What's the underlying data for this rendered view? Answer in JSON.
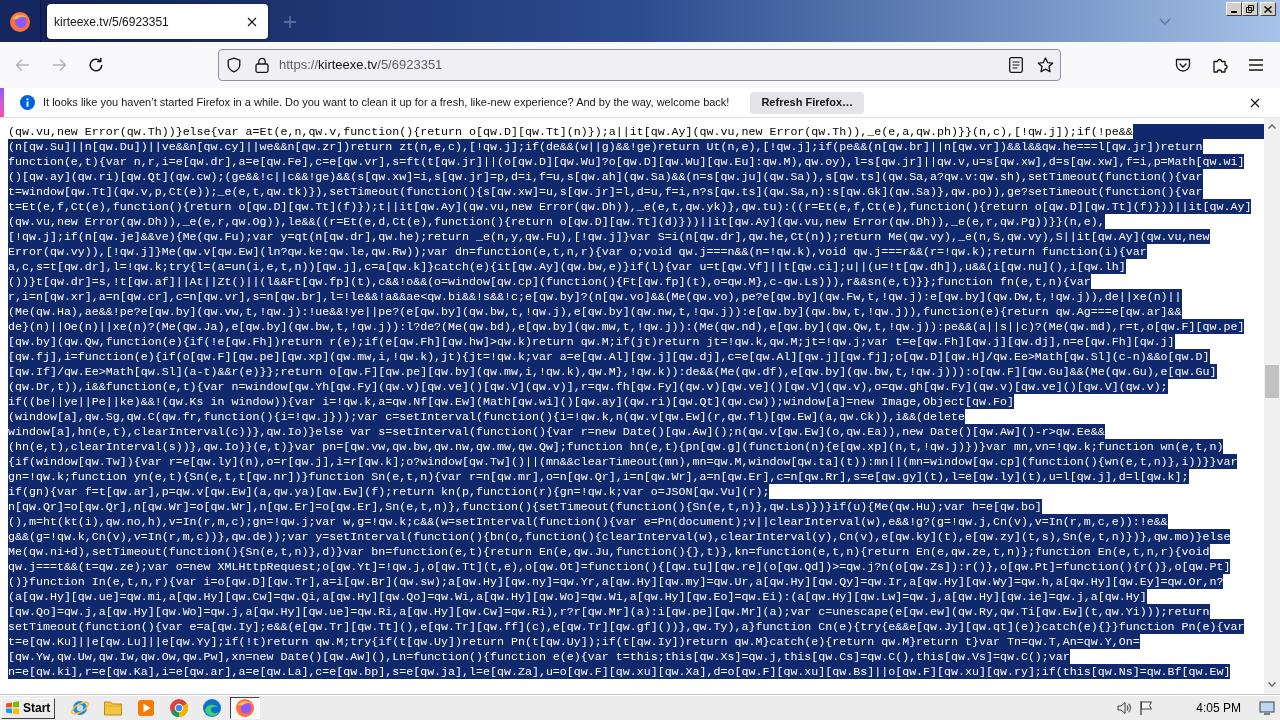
{
  "browser": {
    "tabs": [
      {
        "title": "kirteexe.tv/5/6923351",
        "selected": true
      }
    ],
    "nav_buttons": [
      {
        "kind": "back",
        "disabled": true
      },
      {
        "kind": "forward",
        "disabled": true
      },
      {
        "kind": "reload",
        "disabled": false
      }
    ],
    "url": {
      "scheme": "https://",
      "host": "kirteexe.tv",
      "path": "/5/6923351"
    }
  },
  "notification": {
    "message": "It looks like you haven’t started Firefox in a while. Do you want to clean it up for a fresh, like-new experience? And by the way, welcome back!",
    "button": "Refresh Firefox…"
  },
  "code_lines": [
    {
      "text": "(qw.vu,new Error(qw.Th))}else{var a=Et(e,n,qw.v,function(){return o[qw.D][qw.Tt](n)});a||it[qw.Ay](qw.vu,new Error(qw.Th)),_e(e,a,qw.ph)}}(n,c),[!qw.j]);if(!pe&&",
      "selected": false,
      "trailing_selected": true
    },
    {
      "text": "(n[qw.Su]||n[qw.Du])||ve&&n[qw.cy]||we&&n[qw.zr])return zt(n,e,c),[!qw.j];if(de&&(w||g)&&!ge)return Ut(n,e),[!qw.j];if(pe&&(n[qw.br]||n[qw.vr])&&l&&qw.he===l[qw.jr])return",
      "selected": true,
      "trailing_selected": false
    },
    {
      "text": "function(e,t){var n,r,i=e[qw.dr],a=e[qw.Fe],c=e[qw.vr],s=ft(t[qw.jr]||(o[qw.D][qw.Wu]?o[qw.D][qw.Wu][qw.Eu]:qw.M),qw.oy),l=s[qw.jr]||qw.v,u=s[qw.xw],d=s[qw.xw],f=i,p=Math[qw.wi]",
      "selected": true,
      "trailing_selected": false
    },
    {
      "text": "()[qw.ay](qw.ri)[qw.Qt](qw.cw);(ge&&!c||c&&!ge)&&(s[qw.xw]=i,s[qw.jr]=p,d=i,f=u,s[qw.ah](qw.Sa)&&(n=s[qw.ju](qw.Sa)),s[qw.ts](qw.Sa,a?qw.v:qw.sh),setTimeout(function(){var",
      "selected": true,
      "trailing_selected": false
    },
    {
      "text": "t=window[qw.Tt](qw.v,p,Ct(e));_e(e,t,qw.tk)}),setTimeout(function(){s[qw.xw]=u,s[qw.jr]=l,d=u,f=i,n?s[qw.ts](qw.Sa,n):s[qw.Gk](qw.Sa)},qw.po)),ge?setTimeout(function(){var",
      "selected": true,
      "trailing_selected": false
    },
    {
      "text": "t=Et(e,f,Ct(e),function(){return o[qw.D][qw.Tt](f)});t||it[qw.Ay](qw.vu,new Error(qw.Dh)),_e(e,t,qw.yk)},qw.tu):((r=Et(e,f,Ct(e),function(){return o[qw.D][qw.Tt](f)}))||it[qw.Ay]",
      "selected": true,
      "trailing_selected": false
    },
    {
      "text": "(qw.vu,new Error(qw.Dh)),_e(e,r,qw.Og)),le&&((r=Et(e,d,Ct(e),function(){return o[qw.D][qw.Tt](d)}))||it[qw.Ay](qw.vu,new Error(qw.Dh)),_e(e,r,qw.Pg))}}(n,e),",
      "selected": true,
      "trailing_selected": false
    },
    {
      "text": "[!qw.j];if(n[qw.je]&&ve){Me(qw.Fu);var y=qt(n[qw.dr],qw.he);return _e(n,y,qw.Fu),[!qw.j]}var S=i(n[qw.dr],qw.he,Ct(n));return Me(qw.vy),_e(n,S,qw.vy),S||it[qw.Ay](qw.vu,new",
      "selected": true,
      "trailing_selected": false
    },
    {
      "text": "Error(qw.vy)),[!qw.j]}Me(qw.v[qw.Ew](ln?qw.ke:qw.le,qw.Rw));var dn=function(e,t,n,r){var o;void qw.j===n&&(n=!qw.k),void qw.j===r&&(r=!qw.k);return function(i){var",
      "selected": true,
      "trailing_selected": false
    },
    {
      "text": "a,c,s=t[qw.dr],l=!qw.k;try{l=(a=un(i,e,t,n))[qw.j],c=a[qw.k]}catch(e){it[qw.Ay](qw.bw,e)}if(l){var u=t[qw.Vf]||t[qw.ci];u||(u=!t[qw.dh]),u&&(i[qw.nu](),i[qw.lh]",
      "selected": true,
      "trailing_selected": false
    },
    {
      "text": "())}t[qw.dr]=s,!t[qw.af]||At||Zt()||(l&&Ft[qw.fp](t),c&&!o&&(o=window[qw.cp](function(){Ft[qw.fp](t),o=qw.M},c-qw.Ls))),r&&sn(e,t)}};function fn(e,t,n){var",
      "selected": true,
      "trailing_selected": false
    },
    {
      "text": "r,i=n[qw.xr],a=n[qw.cr],c=n[qw.vr],s=n[qw.br],l=!le&&!a&&ae<qw.bi&&!s&&!c;e[qw.by]?(n[qw.vo]&&(Me(qw.vo),pe?e[qw.by](qw.Fw,t,!qw.j):e[qw.by](qw.Dw,t,!qw.j)),de||xe(n)||",
      "selected": true,
      "trailing_selected": false
    },
    {
      "text": "(Me(qw.Ha),ae&&!pe?e[qw.by](qw.vw,t,!qw.j):!ue&&!ye||pe?(e[qw.by](qw.bw,t,!qw.j),e[qw.by](qw.nw,t,!qw.j)):e[qw.by](qw.bw,t,!qw.j)),function(e){return qw.Ag===e[qw.ar]&&",
      "selected": true,
      "trailing_selected": false
    },
    {
      "text": "de}(n)||Oe(n)||xe(n)?(Me(qw.Ja),e[qw.by](qw.bw,t,!qw.j)):l?de?(Me(qw.bd),e[qw.by](qw.mw,t,!qw.j)):(Me(qw.nd),e[qw.by](qw.Qw,t,!qw.j)):pe&&(a||s||c)?(Me(qw.md),r=t,o[qw.F][qw.pe]",
      "selected": true,
      "trailing_selected": false
    },
    {
      "text": "[qw.by](qw.Qw,function(e){if(!e[qw.Fh])return r(e);if(e[qw.Fh][qw.hw]>qw.k)return qw.M;if(jt)return jt=!qw.k,qw.M;jt=!qw.j;var t=e[qw.Fh][qw.j][qw.dj],n=e[qw.Fh][qw.j]",
      "selected": true,
      "trailing_selected": false
    },
    {
      "text": "[qw.fj],i=function(e){if(o[qw.F][qw.pe][qw.xp](qw.mw,i,!qw.k),jt){jt=!qw.k;var a=e[qw.Al][qw.j][qw.dj],c=e[qw.Al][qw.j][qw.fj];o[qw.D][qw.H]/qw.Ee>Math[qw.Sl](c-n)&&o[qw.D]",
      "selected": true,
      "trailing_selected": false
    },
    {
      "text": "[qw.If]/qw.Ee>Math[qw.Sl](a-t)&&r(e)}};return o[qw.F][qw.pe][qw.by](qw.mw,i,!qw.k),qw.M},!qw.k)):de&&(Me(qw.df),e[qw.by](qw.bw,t,!qw.j))):o[qw.F][qw.Gu]&&(Me(qw.Gu),e[qw.Gu]",
      "selected": true,
      "trailing_selected": false
    },
    {
      "text": "(qw.Dr,t)),i&&function(e,t){var n=window[qw.Yh[qw.Fy](qw.v)[qw.ve]()[qw.V](qw.v)],r=qw.fh[qw.Fy](qw.v)[qw.ve]()[qw.V](qw.v),o=qw.gh[qw.Fy](qw.v)[qw.ve]()[qw.V](qw.v);",
      "selected": true,
      "trailing_selected": false
    },
    {
      "text": "if((be||ye||Pe||ke)&&!(qw.Ks in window)){var i=!qw.k,a=qw.Nf[qw.Ew](Math[qw.wi]()[qw.ay](qw.ri)[qw.Qt](qw.cw));window[a]=new Image,Object[qw.Fo]",
      "selected": true,
      "trailing_selected": false
    },
    {
      "text": "(window[a],qw.Sg,qw.C(qw.fr,function(){i=!qw.j}));var c=setInterval(function(){i=!qw.k,n(qw.v[qw.Ew](r,qw.fl)[qw.Ew](a,qw.Ck)),i&&(delete",
      "selected": true,
      "trailing_selected": false
    },
    {
      "text": "window[a],hn(e,t),clearInterval(c))},qw.Io)}else var s=setInterval(function(){var r=new Date()[qw.Aw]();n(qw.v[qw.Ew](o,qw.Ea)),new Date()[qw.Aw]()-r>qw.Ee&&",
      "selected": true,
      "trailing_selected": false
    },
    {
      "text": "(hn(e,t),clearInterval(s))},qw.Io)}(e,t)}var pn=[qw.vw,qw.bw,qw.nw,qw.mw,qw.Qw];function hn(e,t){pn[qw.g](function(n){e[qw.xp](n,t,!qw.j)})}var mn,vn=!qw.k;function wn(e,t,n)",
      "selected": true,
      "trailing_selected": false
    },
    {
      "text": "{if(window[qw.Tw]){var r=e[qw.ly](n),o=r[qw.j],i=r[qw.k];o?window[qw.Tw]()||(mn&&clearTimeout(mn),mn=qw.M,window[qw.ta](t)):mn||(mn=window[qw.cp](function(){wn(e,t,n)},i))}}var",
      "selected": true,
      "trailing_selected": false
    },
    {
      "text": "gn=!qw.k;function yn(e,t){Sn(e,t,t[qw.nr])}function Sn(e,t,n){var r=n[qw.mr],o=n[qw.Qr],i=n[qw.Wr],a=n[qw.Er],c=n[qw.Rr],s=e[qw.gy](t),l=e[qw.ly](t),u=l[qw.j],d=l[qw.k];",
      "selected": true,
      "trailing_selected": false
    },
    {
      "text": "if(gn){var f=t[qw.ar],p=qw.v[qw.Ew](a,qw.ya)[qw.Ew](f);return kn(p,function(r){gn=!qw.k;var o=JSON[qw.Vu](r);",
      "selected": true,
      "trailing_selected": false
    },
    {
      "text": "n[qw.Qr]=o[qw.Qr],n[qw.Wr]=o[qw.Wr],n[qw.Er]=o[qw.Er],Sn(e,t,n)},function(){setTimeout(function(){Sn(e,t,n)},qw.Ls)})}if(u){Me(qw.Hu);var h=e[qw.bo]",
      "selected": true,
      "trailing_selected": false
    },
    {
      "text": "(),m=ht(kt(i),qw.no,h),v=In(r,m,c);gn=!qw.j;var w,g=!qw.k;c&&(w=setInterval(function(){var e=Pn(document);v||clearInterval(w),e&&!g?(g=!qw.j,Cn(v),v=In(r,m,c,e)):!e&&",
      "selected": true,
      "trailing_selected": false
    },
    {
      "text": "g&&(g=!qw.k,Cn(v),v=In(r,m,c))},qw.de));var y=setInterval(function(){bn(o,function(){clearInterval(w),clearInterval(y),Cn(v),e[qw.ky](t),e[qw.zy](t,s),Sn(e,t,n)})},qw.mo)}else",
      "selected": true,
      "trailing_selected": false
    },
    {
      "text": "Me(qw.ni+d),setTimeout(function(){Sn(e,t,n)},d)}var bn=function(e,t){return En(e,qw.Ju,function(){},t)},kn=function(e,t,n){return En(e,qw.ze,t,n)};function En(e,t,n,r){void",
      "selected": true,
      "trailing_selected": false
    },
    {
      "text": "qw.j===t&&(t=qw.ze);var o=new XMLHttpRequest;o[qw.Yt]=!qw.j,o[qw.Tt](t,e),o[qw.Ot]=function(){[qw.tu][qw.re](o[qw.Qd])>=qw.j?n(o[qw.Zs]):r()},o[qw.Pt]=function(){r()},o[qw.Pt]",
      "selected": true,
      "trailing_selected": false
    },
    {
      "text": "()}function In(e,t,n,r){var i=o[qw.D][qw.Tr],a=i[qw.Br](qw.sw);a[qw.Hy][qw.ny]=qw.Yr,a[qw.Hy][qw.my]=qw.Ur,a[qw.Hy][qw.Qy]=qw.Ir,a[qw.Hy][qw.Wy]=qw.h,a[qw.Hy][qw.Ey]=qw.Or,n?",
      "selected": true,
      "trailing_selected": false
    },
    {
      "text": "(a[qw.Hy][qw.ue]=qw.mi,a[qw.Hy][qw.Cw]=qw.Qi,a[qw.Hy][qw.Qo]=qw.Wi,a[qw.Hy][qw.Wo]=qw.Wi,a[qw.Hy][qw.Eo]=qw.Ei):(a[qw.Hy][qw.Lw]=qw.j,a[qw.Hy][qw.ie]=qw.j,a[qw.Hy]",
      "selected": true,
      "trailing_selected": false
    },
    {
      "text": "[qw.Qo]=qw.j,a[qw.Hy][qw.Wo]=qw.j,a[qw.Hy][qw.ue]=qw.Ri,a[qw.Hy][qw.Cw]=qw.Ri),r?r[qw.Mr](a):i[qw.pe][qw.Mr](a);var c=unescape(e[qw.ew](qw.Ry,qw.Ti[qw.Ew](t,qw.Yi)));return",
      "selected": true,
      "trailing_selected": false
    },
    {
      "text": "setTimeout(function(){var e=a[qw.Iy];e&&(e[qw.Tr][qw.Tt](),e[qw.Tr][qw.ff](c),e[qw.Tr][qw.gf]())},qw.Ty),a}function Cn(e){try{e&&e[qw.Jy][qw.qt](e)}catch(e){}}function Pn(e){var",
      "selected": true,
      "trailing_selected": false
    },
    {
      "text": "t=e[qw.Ku]||e[qw.Lu]||e[qw.Yy];if(!t)return qw.M;try{if(t[qw.Uy])return Pn(t[qw.Uy]);if(t[qw.Iy])return qw.M}catch(e){return qw.M}return t}var Tn=qw.T,An=qw.Y,On=",
      "selected": true,
      "trailing_selected": false
    },
    {
      "text": "[qw.Yw,qw.Uw,qw.Iw,qw.Ow,qw.Pw],xn=new Date()[qw.Aw](),Ln=function(){function e(e){var t=this;this[qw.Xs]=qw.j,this[qw.Cs]=qw.C(),this[qw.Vs]=qw.C();var",
      "selected": true,
      "trailing_selected": false
    },
    {
      "text": "n=e[qw.ki],r=e[qw.Ka],i=e[qw.ar],a=e[qw.La],c=e[qw.bp],s=e[qw.ja],l=e[qw.Za],u=o[qw.F][qw.xu][qw.Xa],d=o[qw.F][qw.xu][qw.Bs]||o[qw.F][qw.xu][qw.ry];if(this[qw.Ns]=qw.Bf[qw.Ew]",
      "selected": true,
      "trailing_selected": false
    }
  ],
  "taskbar": {
    "start": "Start",
    "apps": [
      {
        "kind": "globe",
        "selected": false
      },
      {
        "kind": "folder",
        "selected": false
      },
      {
        "kind": "player",
        "selected": false
      },
      {
        "kind": "ring",
        "selected": false
      },
      {
        "kind": "swirl",
        "selected": false
      },
      {
        "kind": "fox",
        "selected": true
      }
    ],
    "clock": "4:05 PM"
  }
}
